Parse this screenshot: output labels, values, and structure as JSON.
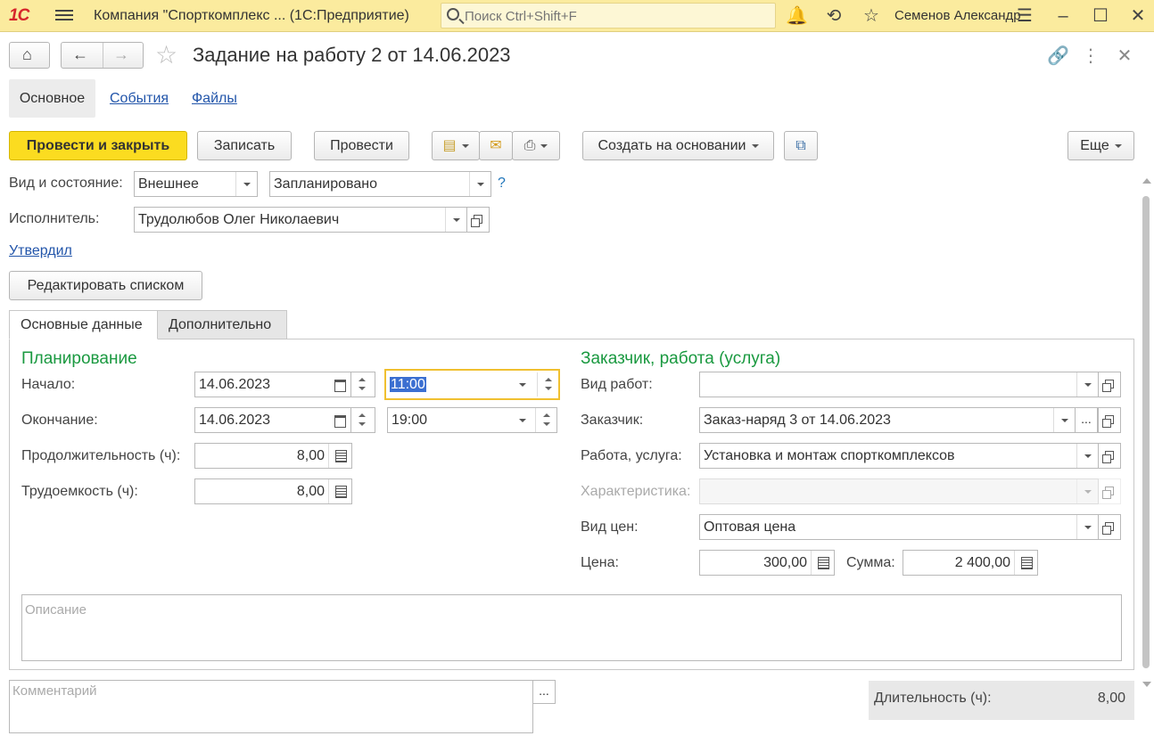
{
  "titlebar": {
    "logo": "1С",
    "title": "Компания \"Спорткомплекс ...   (1С:Предприятие)",
    "search_placeholder": "Поиск Ctrl+Shift+F",
    "user": "Семенов Александр"
  },
  "header": {
    "page_title": "Задание на работу 2 от 14.06.2023"
  },
  "nav_tabs": [
    {
      "label": "Основное"
    },
    {
      "label": "События"
    },
    {
      "label": "Файлы"
    }
  ],
  "toolbar": {
    "post_close": "Провести и закрыть",
    "save": "Записать",
    "post": "Провести",
    "create_based": "Создать на основании",
    "more": "Еще"
  },
  "form": {
    "kind_label": "Вид и состояние:",
    "kind_value": "Внешнее",
    "state_value": "Запланировано",
    "help": "?",
    "executor_label": "Исполнитель:",
    "executor_value": "Трудолюбов Олег Николаевич",
    "approved_link": "Утвердил",
    "edit_list_btn": "Редактировать списком"
  },
  "inner_tabs": [
    {
      "label": "Основные данные"
    },
    {
      "label": "Дополнительно"
    }
  ],
  "planning": {
    "title": "Планирование",
    "start_label": "Начало:",
    "start_date": "14.06.2023",
    "start_time": "11:00",
    "end_label": "Окончание:",
    "end_date": "14.06.2023",
    "end_time": "19:00",
    "duration_label": "Продолжительность (ч):",
    "duration_value": "8,00",
    "labor_label": "Трудоемкость (ч):",
    "labor_value": "8,00"
  },
  "customer": {
    "title": "Заказчик, работа (услуга)",
    "work_type_label": "Вид работ:",
    "work_type_value": "",
    "customer_label": "Заказчик:",
    "customer_value": "Заказ-наряд 3 от 14.06.2023",
    "service_label": "Работа, услуга:",
    "service_value": "Установка и монтаж спорткомплексов",
    "characteristic_label": "Характеристика:",
    "characteristic_value": "",
    "price_type_label": "Вид цен:",
    "price_type_value": "Оптовая цена",
    "price_label": "Цена:",
    "price_value": "300,00",
    "sum_label": "Сумма:",
    "sum_value": "2 400,00"
  },
  "description_placeholder": "Описание",
  "comment_placeholder": "Комментарий",
  "footer": {
    "duration_label": "Длительность (ч):",
    "duration_value": "8,00"
  }
}
